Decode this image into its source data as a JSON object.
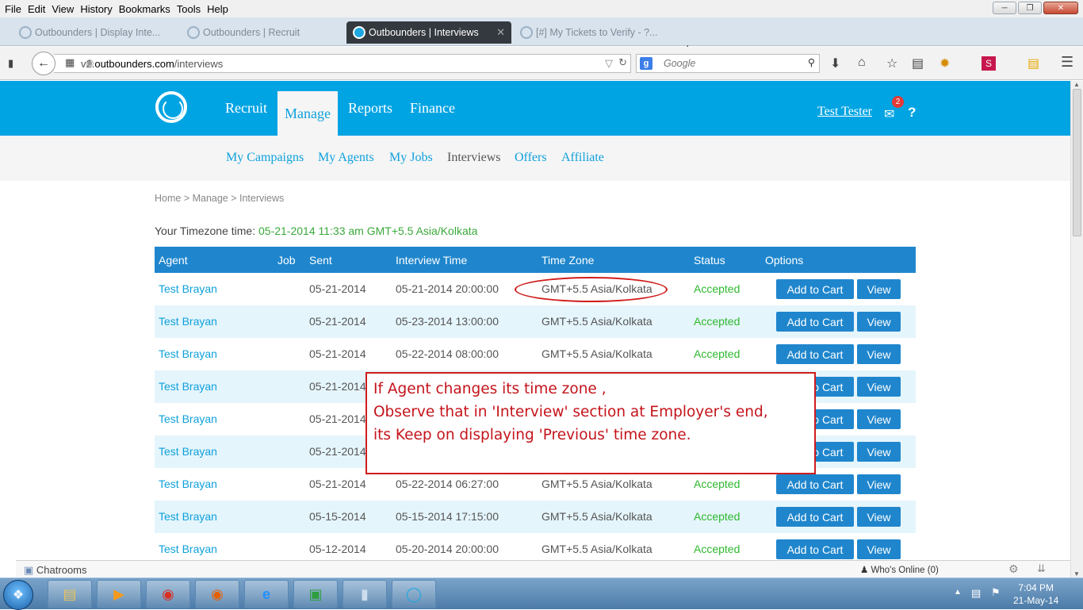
{
  "menubar": {
    "items": [
      "File",
      "Edit",
      "View",
      "History",
      "Bookmarks",
      "Tools",
      "Help"
    ]
  },
  "tabs": [
    {
      "label": "Outbounders | Display Inte..."
    },
    {
      "label": "Outbounders | Recruit"
    },
    {
      "label": "Outbounders | Interviews"
    },
    {
      "label": "[#] My Tickets to Verify - ?..."
    }
  ],
  "navbar": {
    "url_prefix": "v2.",
    "url_domain": "outbounders.com",
    "url_path": "/interviews",
    "search_engine_letter": "g",
    "search_placeholder": "Google"
  },
  "site": {
    "nav": [
      "Recruit",
      "Manage",
      "Reports",
      "Finance"
    ],
    "user": "Test Tester",
    "mail_count": "2",
    "help": "?",
    "subnav": [
      "My Campaigns",
      "My Agents",
      "My Jobs",
      "Interviews",
      "Offers",
      "Affiliate"
    ],
    "breadcrumb": "Home > Manage > Interviews",
    "tz_label": "Your Timezone time:",
    "tz_value": "05-21-2014 11:33 am GMT+5.5 Asia/Kolkata"
  },
  "table": {
    "headers": [
      "Agent",
      "Job",
      "Sent",
      "Interview Time",
      "Time Zone",
      "Status",
      "Options"
    ],
    "add_label": "Add to Cart",
    "view_label": "View",
    "rows": [
      {
        "agent": "Test Brayan",
        "sent": "05-21-2014",
        "itime": "05-21-2014 20:00:00",
        "tz": "GMT+5.5 Asia/Kolkata",
        "status": "Accepted"
      },
      {
        "agent": "Test Brayan",
        "sent": "05-21-2014",
        "itime": "05-23-2014 13:00:00",
        "tz": "GMT+5.5 Asia/Kolkata",
        "status": "Accepted"
      },
      {
        "agent": "Test Brayan",
        "sent": "05-21-2014",
        "itime": "05-22-2014 08:00:00",
        "tz": "GMT+5.5 Asia/Kolkata",
        "status": "Accepted"
      },
      {
        "agent": "Test Brayan",
        "sent": "05-21-2014",
        "itime": "",
        "tz": "",
        "status": ""
      },
      {
        "agent": "Test Brayan",
        "sent": "05-21-2014",
        "itime": "",
        "tz": "",
        "status": ""
      },
      {
        "agent": "Test Brayan",
        "sent": "05-21-2014",
        "itime": "",
        "tz": "",
        "status": ""
      },
      {
        "agent": "Test Brayan",
        "sent": "05-21-2014",
        "itime": "05-22-2014 06:27:00",
        "tz": "GMT+5.5 Asia/Kolkata",
        "status": "Accepted"
      },
      {
        "agent": "Test Brayan",
        "sent": "05-15-2014",
        "itime": "05-15-2014 17:15:00",
        "tz": "GMT+5.5 Asia/Kolkata",
        "status": "Accepted"
      },
      {
        "agent": "Test Brayan",
        "sent": "05-12-2014",
        "itime": "05-20-2014 20:00:00",
        "tz": "GMT+5.5 Asia/Kolkata",
        "status": "Accepted"
      }
    ]
  },
  "callout": {
    "line1": "If Agent changes its time zone ,",
    "line2": "Observe that in 'Interview' section at Employer's end,",
    "line3": "its Keep on displaying 'Previous' time zone."
  },
  "chatbar": {
    "chatrooms": "Chatrooms",
    "whos_online": "Who's Online (0)"
  },
  "taskbar": {
    "time": "7:04 PM",
    "date": "21-May-14"
  },
  "colors": {
    "brand": "#00a4e3",
    "table_header": "#1f86cd",
    "accepted": "#2eb82e",
    "annotation": "#d01c1c"
  }
}
